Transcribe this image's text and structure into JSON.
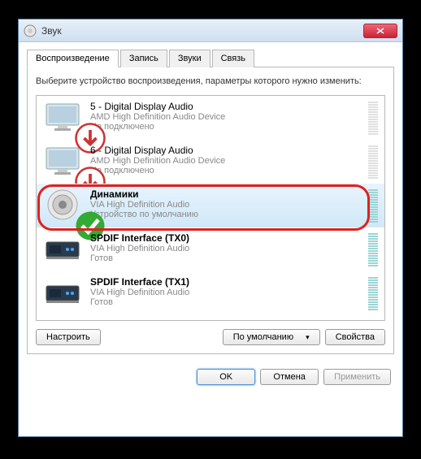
{
  "window": {
    "title": "Звук"
  },
  "tabs": [
    {
      "label": "Воспроизведение",
      "active": true
    },
    {
      "label": "Запись",
      "active": false
    },
    {
      "label": "Звуки",
      "active": false
    },
    {
      "label": "Связь",
      "active": false
    }
  ],
  "instruction": "Выберите устройство воспроизведения, параметры которого нужно изменить:",
  "devices": [
    {
      "name": "5 - Digital Display Audio",
      "desc": "AMD High Definition Audio Device",
      "status": "Не подключено",
      "iconType": "monitor",
      "overlay": "down",
      "selected": false,
      "highlighted": false,
      "bold": false
    },
    {
      "name": "6 - Digital Display Audio",
      "desc": "AMD High Definition Audio Device",
      "status": "Не подключено",
      "iconType": "monitor",
      "overlay": "down",
      "selected": false,
      "highlighted": false,
      "bold": false
    },
    {
      "name": "Динамики",
      "desc": "VIA High Definition Audio",
      "status": "Устройство по умолчанию",
      "iconType": "speaker",
      "overlay": "check",
      "selected": true,
      "highlighted": true,
      "bold": true
    },
    {
      "name": "SPDIF Interface (TX0)",
      "desc": "VIA High Definition Audio",
      "status": "Готов",
      "iconType": "spdif",
      "overlay": "",
      "selected": false,
      "highlighted": false,
      "bold": true
    },
    {
      "name": "SPDIF Interface (TX1)",
      "desc": "VIA High Definition Audio",
      "status": "Готов",
      "iconType": "spdif",
      "overlay": "",
      "selected": false,
      "highlighted": false,
      "bold": true
    }
  ],
  "buttons": {
    "configure": "Настроить",
    "setDefault": "По умолчанию",
    "properties": "Свойства",
    "ok": "OK",
    "cancel": "Отмена",
    "apply": "Применить"
  }
}
